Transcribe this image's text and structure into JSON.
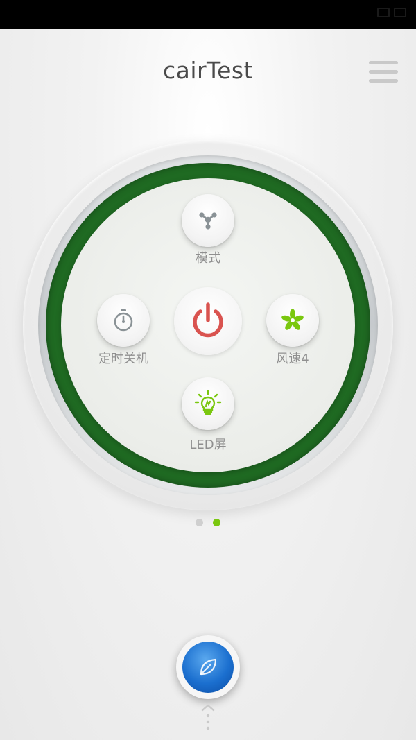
{
  "app": {
    "title": "cairTest",
    "menu_icon": "hamburger-menu-icon"
  },
  "controls": {
    "mode": {
      "label": "模式",
      "icon": "nodes-icon"
    },
    "timer": {
      "label": "定时关机",
      "icon": "stopwatch-icon"
    },
    "power": {
      "icon": "power-icon",
      "color": "#d9534f"
    },
    "fan_speed": {
      "label": "风速4",
      "icon": "fan-icon"
    },
    "led": {
      "label": "LED屏",
      "icon": "lightbulb-icon"
    }
  },
  "pager": {
    "total_pages": 2,
    "active_index": 1
  },
  "bottom": {
    "icon": "leaf-icon",
    "hint_icon": "swipe-up-icon"
  },
  "colors": {
    "ring": "#1f6a22",
    "accent": "#7ac70f",
    "power": "#d9534f",
    "icon_gray": "#8a9296",
    "button_blue": "#1b6fcf"
  }
}
